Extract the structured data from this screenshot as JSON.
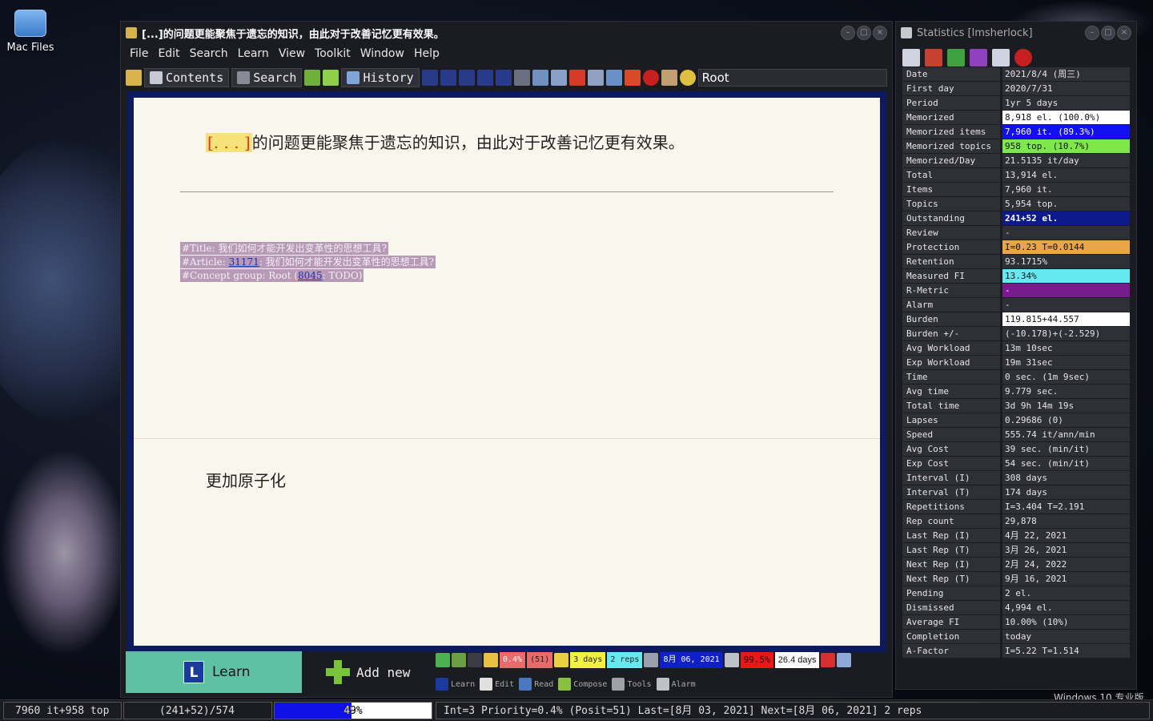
{
  "desktop": {
    "icon_label": "Mac Files"
  },
  "main_window": {
    "title": "[...]的问题更能聚焦于遗忘的知识，由此对于改善记忆更有效果。",
    "menu": [
      "File",
      "Edit",
      "Search",
      "Learn",
      "View",
      "Toolkit",
      "Window",
      "Help"
    ],
    "toolbar": {
      "contents_label": "Contents",
      "search_label": "Search",
      "history_label": "History",
      "path": "Root"
    },
    "question": {
      "cloze": "[. . . ]",
      "text": "的问题更能聚焦于遗忘的知识，由此对于改善记忆更有效果。"
    },
    "refs": {
      "title_line": "#Title: 我们如何才能开发出变革性的思想工具?",
      "article_prefix": "#Article: ",
      "article_link": "31171",
      "article_suffix": ": 我们如何才能开发出变革性的思想工具?",
      "concept_prefix": "#Concept group: Root (",
      "concept_link": "8045",
      "concept_suffix": ": TODO)"
    },
    "answer": "更加原子化",
    "learn_button": {
      "icon": "L",
      "label": "Learn"
    },
    "add_new_button": {
      "label": "Add new"
    },
    "status": {
      "priority": "0.4%",
      "position": "(51)",
      "interval": "3 days",
      "reps": "2 reps",
      "date": "8月 06, 2021",
      "retention": "99.5%",
      "days": "26.4 days"
    },
    "modes": [
      "Learn",
      "Edit",
      "Read",
      "Compose",
      "Tools",
      "Alarm"
    ]
  },
  "stats_window": {
    "title": "Statistics [lmsherlock]",
    "rows": [
      {
        "k": "Date",
        "v": "2021/8/4 (周三)"
      },
      {
        "k": "First day",
        "v": "2020/7/31"
      },
      {
        "k": "Period",
        "v": "1yr 5 days"
      },
      {
        "k": "Memorized",
        "v": "8,918 el. (100.0%)"
      },
      {
        "k": "Memorized items",
        "v": "7,960 it. (89.3%)"
      },
      {
        "k": "Memorized topics",
        "v": "958 top. (10.7%)"
      },
      {
        "k": "Memorized/Day",
        "v": "21.5135 it/day"
      },
      {
        "k": "Total",
        "v": "13,914 el."
      },
      {
        "k": "Items",
        "v": "7,960 it."
      },
      {
        "k": "Topics",
        "v": "5,954 top."
      },
      {
        "k": "Outstanding",
        "v": "241+52 el."
      },
      {
        "k": "Review",
        "v": "-"
      },
      {
        "k": "Protection",
        "v": "I=0.23 T=0.0144"
      },
      {
        "k": "Retention",
        "v": "93.1715%"
      },
      {
        "k": "Measured FI",
        "v": "13.34%"
      },
      {
        "k": "R-Metric",
        "v": "-"
      },
      {
        "k": "Alarm",
        "v": "-"
      },
      {
        "k": "Burden",
        "v": "119.815+44.557"
      },
      {
        "k": "Burden +/-",
        "v": "(-10.178)+(-2.529)"
      },
      {
        "k": "Avg Workload",
        "v": "13m 10sec"
      },
      {
        "k": "Exp Workload",
        "v": "19m 31sec"
      },
      {
        "k": "Time",
        "v": "0 sec. (1m 9sec)"
      },
      {
        "k": "Avg time",
        "v": "9.779 sec."
      },
      {
        "k": "Total time",
        "v": "3d 9h 14m 19s"
      },
      {
        "k": "Lapses",
        "v": "0.29686 (0)"
      },
      {
        "k": "Speed",
        "v": "555.74 it/ann/min"
      },
      {
        "k": "Avg Cost",
        "v": "39 sec. (min/it)"
      },
      {
        "k": "Exp Cost",
        "v": "54 sec. (min/it)"
      },
      {
        "k": "Interval (I)",
        "v": "308 days"
      },
      {
        "k": "Interval (T)",
        "v": "174 days"
      },
      {
        "k": "Repetitions",
        "v": "I=3.404 T=2.191"
      },
      {
        "k": "Rep count",
        "v": "29,878"
      },
      {
        "k": "Last Rep (I)",
        "v": "4月 22, 2021"
      },
      {
        "k": "Last Rep (T)",
        "v": "3月 26, 2021"
      },
      {
        "k": "Next Rep (I)",
        "v": "2月 24, 2022"
      },
      {
        "k": "Next Rep (T)",
        "v": "9月 16, 2021"
      },
      {
        "k": "Pending",
        "v": "2 el."
      },
      {
        "k": "Dismissed",
        "v": "4,994 el."
      },
      {
        "k": "Average FI",
        "v": "10.00% (10%)"
      },
      {
        "k": "Completion",
        "v": "today"
      },
      {
        "k": "A-Factor",
        "v": "I=5.22 T=1.514"
      }
    ]
  },
  "bottom_bar": {
    "counts": "7960 it+958 top",
    "outstanding": "(241+52)/574",
    "progress_label": "49%",
    "progress": 0.49,
    "info": "Int=3 Priority=0.4% (Posit=51) Last=[8月 03, 2021] Next=[8月 06, 2021] 2 reps"
  },
  "overlay": {
    "windows_text": "Windows 10 专业版"
  },
  "colors": {
    "accent_learn": "#5ec1a3",
    "memorized_items": "#1010f0",
    "memorized_topics": "#7ee84a",
    "outstanding": "#0c1a8c",
    "protection": "#e8a54a",
    "measured_fi": "#66e8f0",
    "r_metric": "#7a1a90"
  }
}
